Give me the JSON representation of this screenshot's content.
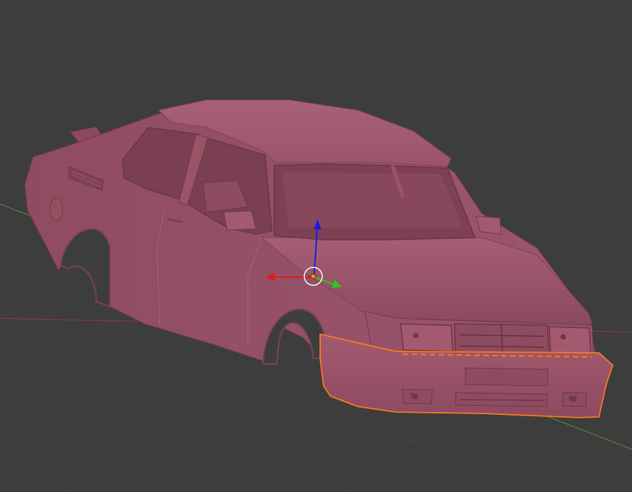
{
  "viewport": {
    "background_color": "#3d3d3d",
    "grid_color": "#4a4a4a"
  },
  "axes": {
    "x_axis_color": "#8c3a3a",
    "y_axis_color": "#4f8a3a"
  },
  "model": {
    "body_color": "#9a5468",
    "body_light_color": "#b06a80",
    "body_dark_color": "#6e3a4a",
    "selection_outline_color": "#ff7a1a"
  },
  "manipulator": {
    "x_handle_color": "#e01a1a",
    "y_handle_color": "#22cc22",
    "z_handle_color": "#1a1ae0",
    "pivot_color": "#ff8c1a",
    "ring_color": "#ffffff"
  }
}
